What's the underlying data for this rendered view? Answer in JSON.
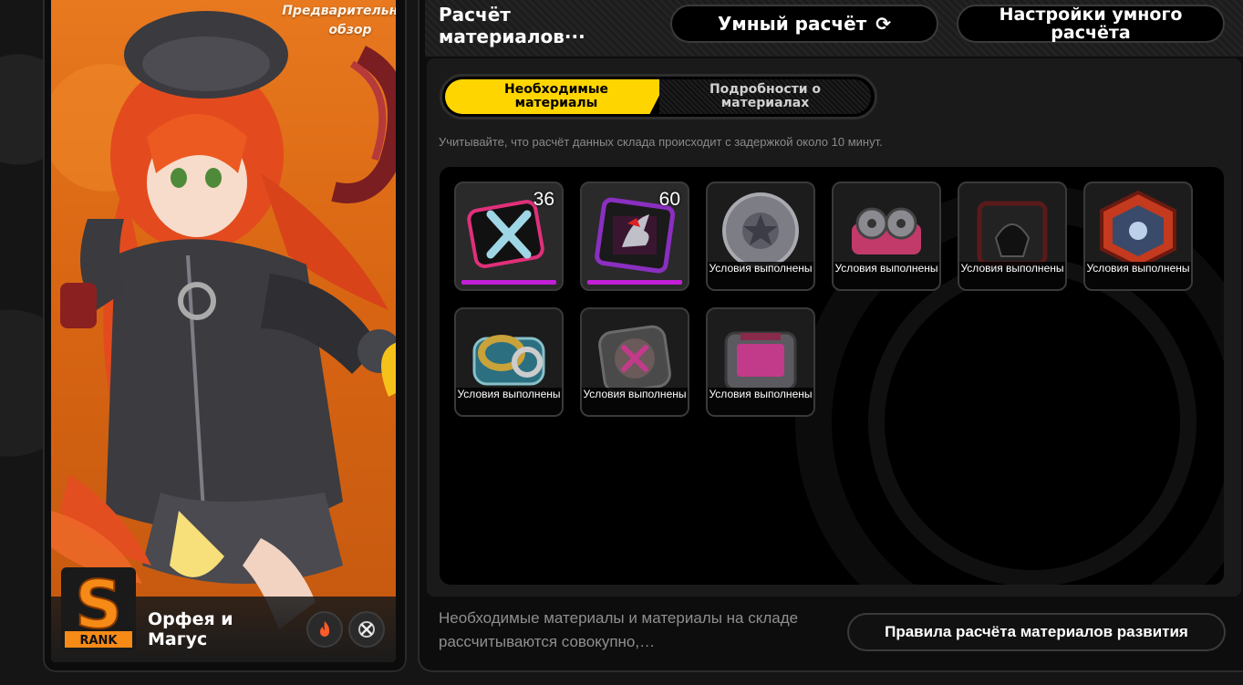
{
  "character": {
    "preview_label": "Предварительный обзор",
    "name": "Орфея и Магус",
    "rank": "S",
    "rank_sub": "RANK",
    "attribute_icon": "fire-attribute-icon",
    "specialty_icon": "crossed-blades-icon"
  },
  "header": {
    "title": "Расчёт материалов···",
    "smart_calc_label": "Умный расчёт",
    "smart_calc_icon": "refresh-icon",
    "settings_label": "Настройки умного расчёта"
  },
  "tabs": {
    "active_label": "Необходимые материалы",
    "inactive_label": "Подробности о материалах"
  },
  "notice": "Учитывайте, что расчёт данных склада происходит с задержкой около 10 минут.",
  "materials": [
    {
      "icon": "cross-chip-material-icon",
      "count": "36",
      "status": ""
    },
    {
      "icon": "shadow-core-material-icon",
      "count": "60",
      "status": ""
    },
    {
      "icon": "star-coin-material-icon",
      "count": "",
      "status": "Условия выполнены"
    },
    {
      "icon": "reel-device-material-icon",
      "count": "",
      "status": "Условия выполнены"
    },
    {
      "icon": "dark-module-material-icon",
      "count": "",
      "status": "Условия выполнены"
    },
    {
      "icon": "badge-chip-material-icon",
      "count": "",
      "status": "Условия выполнены"
    },
    {
      "icon": "gold-ring-material-icon",
      "count": "",
      "status": "Условия выполнены"
    },
    {
      "icon": "x-disc-material-icon",
      "count": "",
      "status": "Условия выполнены"
    },
    {
      "icon": "pink-case-material-icon",
      "count": "",
      "status": "Условия выполнены"
    }
  ],
  "footer": {
    "note": "Необходимые материалы и материалы на складе рассчитываются совокупно,…",
    "rules_button": "Правила расчёта материалов развития"
  },
  "colors": {
    "accent_yellow": "#ffd500",
    "card_orange": "#e0701a",
    "rarity_purple": "#c21fd6"
  }
}
